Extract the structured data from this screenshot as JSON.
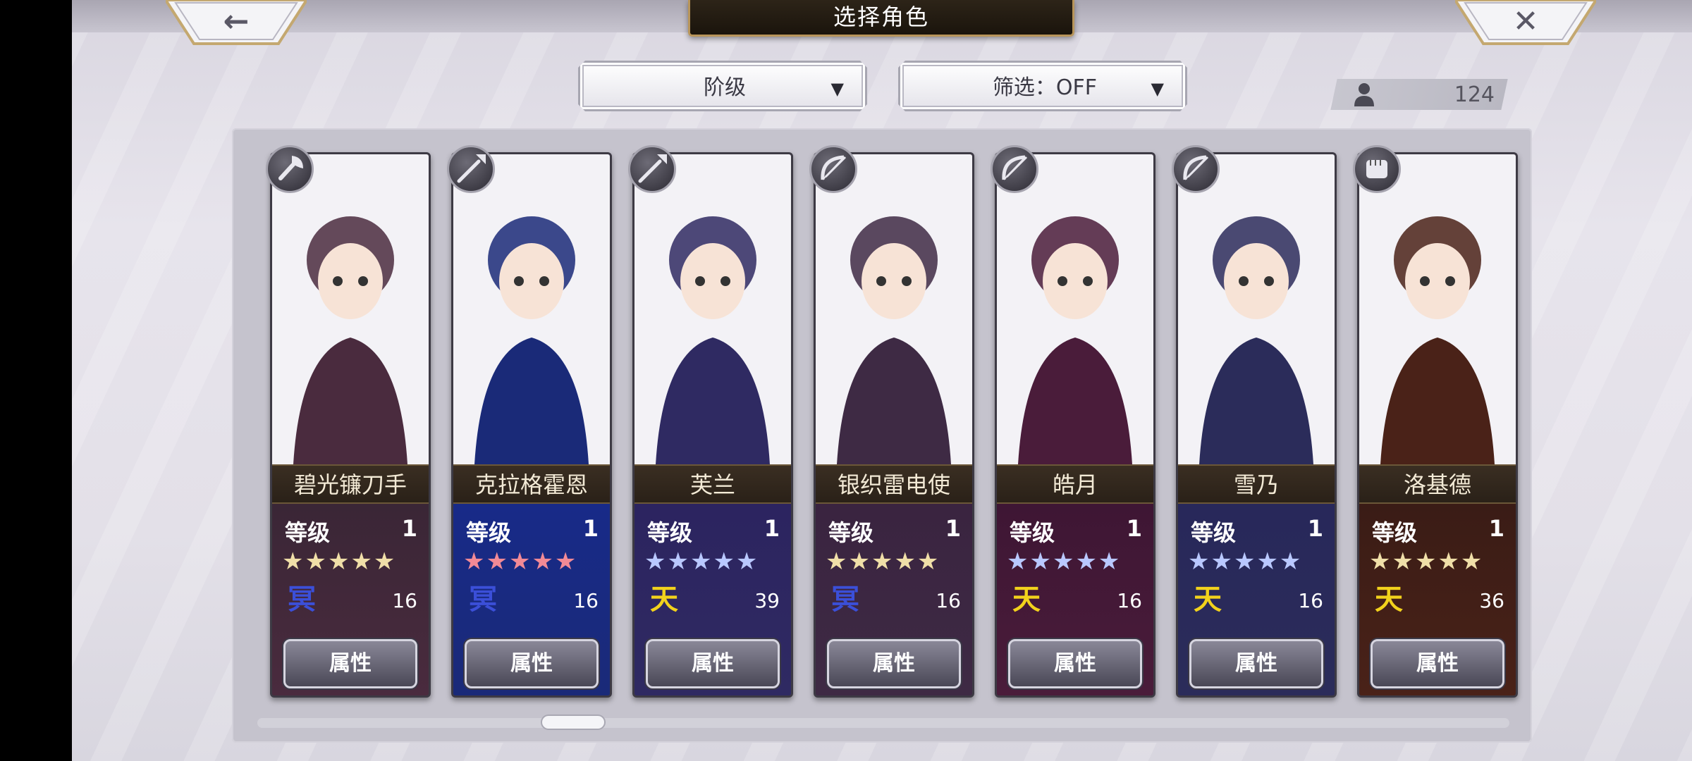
{
  "header": {
    "title": "选择角色"
  },
  "nav": {
    "back_glyph": "←",
    "close_glyph": "✕"
  },
  "filters": {
    "rank_label": "阶级",
    "filter_label": "筛选：OFF",
    "caret": "▼"
  },
  "roster": {
    "count": "124",
    "icon": "person-icon"
  },
  "cards": [
    {
      "name": "碧光镰刀手",
      "level_label": "等级",
      "level": "1",
      "stars": "★★★★★",
      "star_color": "#f0dfa8",
      "element": "冥",
      "element_color": "#3b4fd8",
      "value": "16",
      "button": "属性",
      "class_icon": "axe-icon",
      "bg": "#4a2b3e",
      "stats_bg": "#3a2636"
    },
    {
      "name": "克拉格霍恩",
      "level_label": "等级",
      "level": "1",
      "stars": "★★★★★",
      "star_color": "#f28a96",
      "element": "冥",
      "element_color": "#3b4fd8",
      "value": "16",
      "button": "属性",
      "class_icon": "spear-icon",
      "bg": "#1a2a78",
      "stats_bg": "#182a88"
    },
    {
      "name": "芙兰",
      "level_label": "等级",
      "level": "1",
      "stars": "★★★★★",
      "star_color": "#b9c8ff",
      "element": "天",
      "element_color": "#f2d21c",
      "value": "39",
      "button": "属性",
      "class_icon": "spear-icon",
      "bg": "#2f2a62",
      "stats_bg": "#2c2460"
    },
    {
      "name": "银织雷电使",
      "level_label": "等级",
      "level": "1",
      "stars": "★★★★★",
      "star_color": "#f0dfa8",
      "element": "冥",
      "element_color": "#3b4fd8",
      "value": "16",
      "button": "属性",
      "class_icon": "bow-icon",
      "bg": "#3e2a44",
      "stats_bg": "#3a2440"
    },
    {
      "name": "皓月",
      "level_label": "等级",
      "level": "1",
      "stars": "★★★★★",
      "star_color": "#b9c8ff",
      "element": "天",
      "element_color": "#f2d21c",
      "value": "16",
      "button": "属性",
      "class_icon": "bow-icon",
      "bg": "#4a1c3a",
      "stats_bg": "#3e1634"
    },
    {
      "name": "雪乃",
      "level_label": "等级",
      "level": "1",
      "stars": "★★★★★",
      "star_color": "#b9c8ff",
      "element": "天",
      "element_color": "#f2d21c",
      "value": "16",
      "button": "属性",
      "class_icon": "bow-icon",
      "bg": "#2b2c5a",
      "stats_bg": "#28285a"
    },
    {
      "name": "洛基德",
      "level_label": "等级",
      "level": "1",
      "stars": "★★★★★",
      "star_color": "#f0dfa8",
      "element": "天",
      "element_color": "#f2d21c",
      "value": "36",
      "button": "属性",
      "class_icon": "fist-icon",
      "bg": "#4a2218",
      "stats_bg": "#3a1c16"
    }
  ]
}
